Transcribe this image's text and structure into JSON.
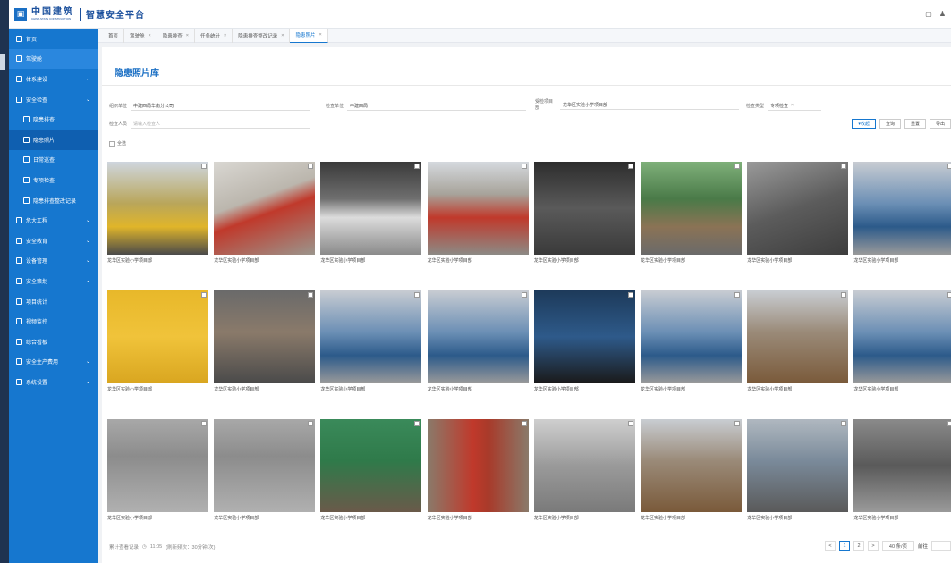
{
  "brand": {
    "name": "中国建筑",
    "subtitle": "CHINA STATE CONSTRUCTION",
    "platform": "智慧安全平台"
  },
  "sidebar": {
    "items": [
      {
        "label": "首页",
        "sub": false,
        "chev": false
      },
      {
        "label": "驾驶舱",
        "sub": false,
        "chev": false,
        "highlight": true
      },
      {
        "label": "体系建设",
        "sub": false,
        "chev": true
      },
      {
        "label": "安全检查",
        "sub": false,
        "chev": true
      },
      {
        "label": "隐患排查",
        "sub": true,
        "chev": false
      },
      {
        "label": "隐患照片",
        "sub": true,
        "chev": false,
        "active": true
      },
      {
        "label": "日常巡查",
        "sub": true,
        "chev": false
      },
      {
        "label": "专项检查",
        "sub": true,
        "chev": false
      },
      {
        "label": "隐患排查整改记录",
        "sub": true,
        "chev": false
      },
      {
        "label": "危大工程",
        "sub": false,
        "chev": true
      },
      {
        "label": "安全教育",
        "sub": false,
        "chev": true
      },
      {
        "label": "设备管理",
        "sub": false,
        "chev": true
      },
      {
        "label": "安全策划",
        "sub": false,
        "chev": true
      },
      {
        "label": "项目统计",
        "sub": false,
        "chev": false
      },
      {
        "label": "视频监控",
        "sub": false,
        "chev": false
      },
      {
        "label": "综合看板",
        "sub": false,
        "chev": false
      },
      {
        "label": "安全生产费用",
        "sub": false,
        "chev": true
      },
      {
        "label": "系统设置",
        "sub": false,
        "chev": true
      }
    ]
  },
  "tabs": [
    {
      "label": "首页",
      "closable": false
    },
    {
      "label": "驾驶舱",
      "closable": true
    },
    {
      "label": "隐患排查",
      "closable": true
    },
    {
      "label": "任务统计",
      "closable": true
    },
    {
      "label": "隐患排查整改记录",
      "closable": true
    },
    {
      "label": "隐患照片",
      "closable": true,
      "active": true
    }
  ],
  "page": {
    "title": "隐患照片库"
  },
  "filters": {
    "org_label": "组织单位",
    "org_value": "中建四局华南分公司",
    "check_unit_label": "检查单位",
    "check_unit_value": "中建四局",
    "project_label": "受检项目部",
    "project_value": "龙华区实验小学项目部",
    "check_type_label": "检查类型",
    "check_type_value": "专项检查",
    "inspector_label": "检查人员",
    "inspector_placeholder": "请输入检查人"
  },
  "buttons": {
    "collapse": "收起",
    "search": "查询",
    "reset": "重置",
    "export": "导出"
  },
  "select_all": "全选",
  "caption": "龙华区实验小学项目部",
  "photos": [
    {
      "bg": "linear-gradient(180deg,#cfd6de 0%,#b9a65a 45%,#e0b52a 70%,#4a4a4a 100%)"
    },
    {
      "bg": "linear-gradient(160deg,#d9d7d2 0%,#bbb6ad 40%,#c0392b 55%,#9b958c 100%)"
    },
    {
      "bg": "linear-gradient(180deg,#3a3a3a 0%,#6f6f6f 40%,#dcdcdc 60%,#8a8a8a 100%)"
    },
    {
      "bg": "linear-gradient(180deg,#d5d9de 0%,#a7a39a 35%,#c0392b 60%,#8c8a85 100%)"
    },
    {
      "bg": "linear-gradient(180deg,#2d2d2d 0%,#5a5a5a 50%,#3a3a3a 100%)"
    },
    {
      "bg": "linear-gradient(180deg,#7fb07a 0%,#4a7a48 40%,#8b7355 70%,#6a6a6a 100%)"
    },
    {
      "bg": "linear-gradient(160deg,#9a9a9a 0%,#5c5c5c 50%,#3d3d3d 100%)"
    },
    {
      "bg": "linear-gradient(180deg,#c8ccd2 0%,#6b8fb5 45%,#2c5a8a 70%,#9a9a9a 100%)"
    },
    {
      "bg": "linear-gradient(180deg,#e8b82a 0%,#f0c33a 50%,#d9a620 100%)"
    },
    {
      "bg": "linear-gradient(180deg,#6a6a6a 0%,#8a7a6a 45%,#4a4a4a 100%)"
    },
    {
      "bg": "linear-gradient(180deg,#c8ccd2 0%,#6b8fb5 45%,#2c5a8a 70%,#9a9a9a 100%)"
    },
    {
      "bg": "linear-gradient(180deg,#c8ccd2 0%,#6b8fb5 45%,#2c5a8a 70%,#9a9a9a 100%)"
    },
    {
      "bg": "linear-gradient(180deg,#1d3a5a 0%,#2e5a8a 50%,#1a1a1a 100%)"
    },
    {
      "bg": "linear-gradient(180deg,#c8ccd2 0%,#6b8fb5 45%,#2c5a8a 70%,#9a9a9a 100%)"
    },
    {
      "bg": "linear-gradient(180deg,#c9cdd2 0%,#9a8a78 45%,#7a5a3a 100%)"
    },
    {
      "bg": "linear-gradient(180deg,#c8ccd2 0%,#6b8fb5 45%,#2c5a8a 70%,#9a9a9a 100%)"
    },
    {
      "bg": "linear-gradient(180deg,#a8a8a8 0%,#8c8c8c 40%,#b0b0b0 100%)"
    },
    {
      "bg": "linear-gradient(180deg,#a8a8a8 0%,#8c8c8c 40%,#b0b0b0 100%)"
    },
    {
      "bg": "linear-gradient(180deg,#3a8a5a 0%,#2f7a4a 45%,#6a5a4a 100%)"
    },
    {
      "bg": "linear-gradient(90deg,#8a7a6a 0%,#c0392b 45%,#a83a2a 60%,#8a7a6a 100%)"
    },
    {
      "bg": "linear-gradient(180deg,#cfcfcf 0%,#9a9a9a 50%,#7a7a7a 100%)"
    },
    {
      "bg": "linear-gradient(180deg,#c9cdd2 0%,#9a8a78 45%,#7a5a3a 100%)"
    },
    {
      "bg": "linear-gradient(180deg,#b0b8c0 0%,#7a8a9a 45%,#5a5a5a 100%)"
    },
    {
      "bg": "linear-gradient(180deg,#8a8a8a 0%,#5a5a5a 50%,#9a9a9a 100%)"
    }
  ],
  "footer": {
    "prefix": "累计查看记录",
    "time": "11:05",
    "note": "(刷新频次：30分钟/次)"
  },
  "pager": {
    "prev": "<",
    "pages": [
      "1",
      "2"
    ],
    "next": ">",
    "page_size": "40 条/页",
    "goto_label": "前往"
  }
}
